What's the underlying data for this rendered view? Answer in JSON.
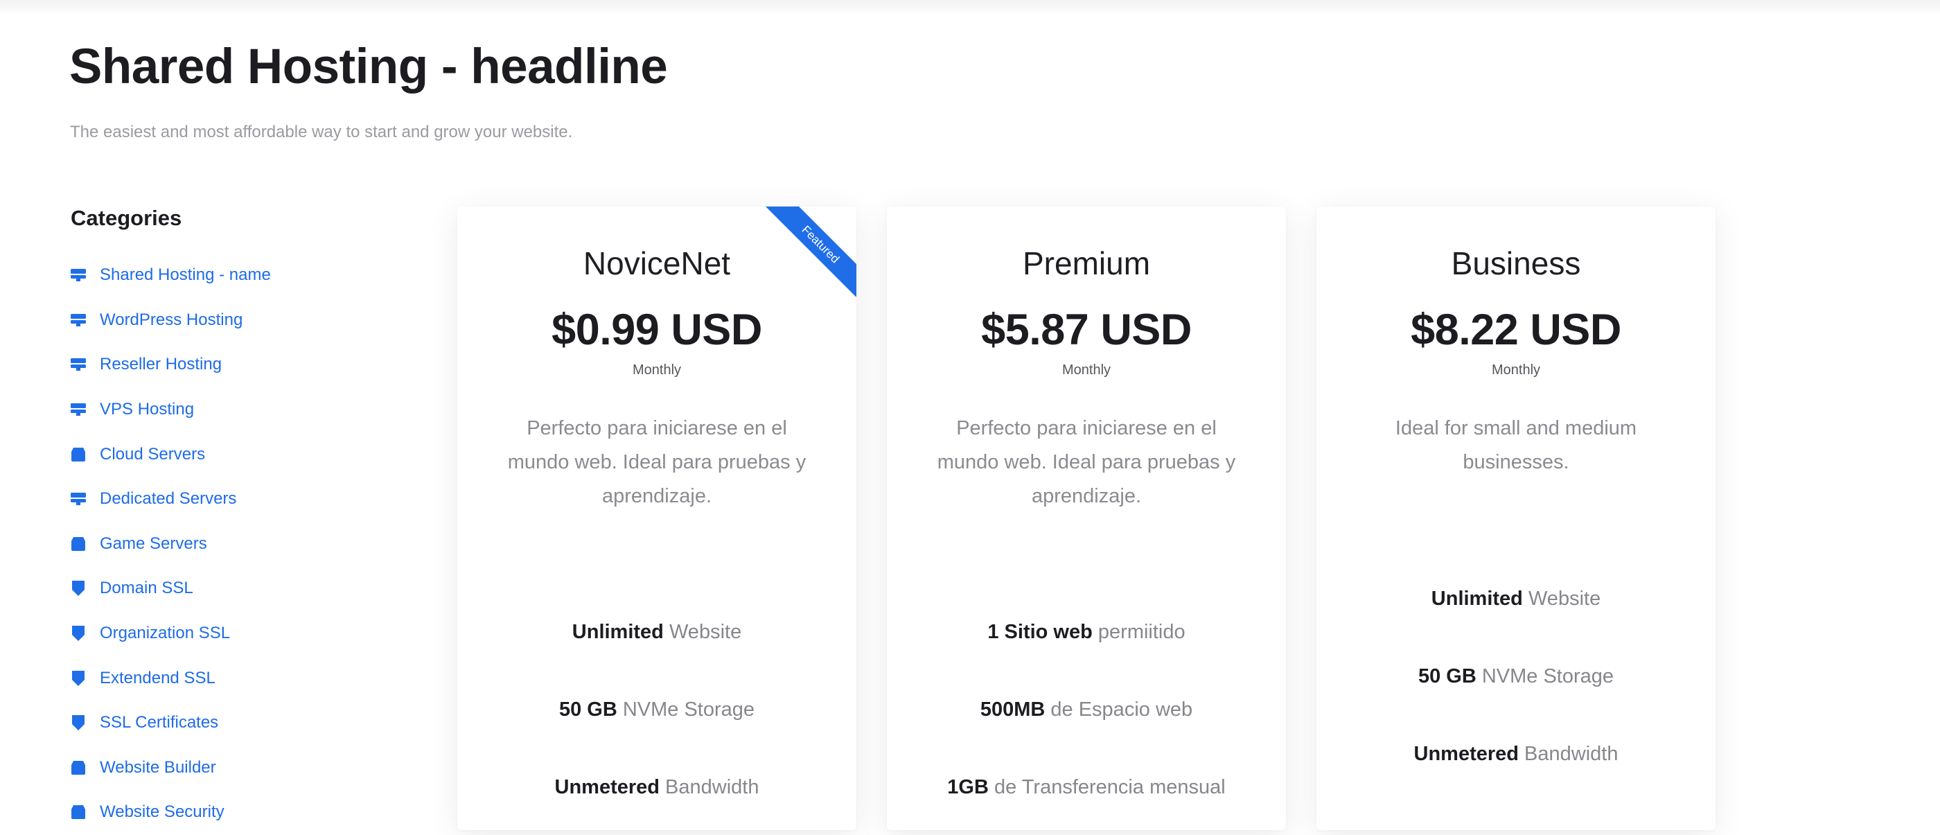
{
  "page": {
    "title": "Shared Hosting - headline",
    "subtitle": "The easiest and most affordable way to start and grow your website."
  },
  "sidebar": {
    "title": "Categories",
    "items": [
      {
        "label": "Shared Hosting - name",
        "icon": "server-icon"
      },
      {
        "label": "WordPress Hosting",
        "icon": "server-icon"
      },
      {
        "label": "Reseller Hosting",
        "icon": "server-icon"
      },
      {
        "label": "VPS Hosting",
        "icon": "server-icon"
      },
      {
        "label": "Cloud Servers",
        "icon": "box-icon"
      },
      {
        "label": "Dedicated Servers",
        "icon": "server-icon"
      },
      {
        "label": "Game Servers",
        "icon": "box-icon"
      },
      {
        "label": "Domain SSL",
        "icon": "shield-icon"
      },
      {
        "label": "Organization SSL",
        "icon": "shield-icon"
      },
      {
        "label": "Extendend SSL",
        "icon": "shield-icon"
      },
      {
        "label": "SSL Certificates",
        "icon": "shield-icon"
      },
      {
        "label": "Website Builder",
        "icon": "box-icon"
      },
      {
        "label": "Website Security",
        "icon": "box-icon"
      }
    ]
  },
  "plans": [
    {
      "name": "NoviceNet",
      "price": "$0.99 USD",
      "cycle": "Monthly",
      "description": "Perfecto para iniciarese en el mundo web. Ideal para pruebas y aprendizaje.",
      "ribbon": "Featured",
      "features": [
        {
          "strong": "Unlimited",
          "rest": " Website"
        },
        {
          "strong": "50 GB",
          "rest": " NVMe Storage"
        },
        {
          "strong": "Unmetered",
          "rest": " Bandwidth"
        }
      ]
    },
    {
      "name": "Premium",
      "price": "$5.87 USD",
      "cycle": "Monthly",
      "description": "Perfecto para iniciarese en el mundo web. Ideal para pruebas y aprendizaje.",
      "features": [
        {
          "strong": "1 Sitio web",
          "rest": " permiitido"
        },
        {
          "strong": "500MB",
          "rest": " de Espacio web"
        },
        {
          "strong": "1GB",
          "rest": " de Transferencia mensual"
        }
      ]
    },
    {
      "name": "Business",
      "price": "$8.22 USD",
      "cycle": "Monthly",
      "description": "Ideal for small and medium businesses.",
      "features": [
        {
          "strong": "Unlimited",
          "rest": " Website"
        },
        {
          "strong": "50 GB",
          "rest": " NVMe Storage"
        },
        {
          "strong": "Unmetered",
          "rest": " Bandwidth"
        }
      ]
    }
  ],
  "colors": {
    "accent": "#1f6ee8",
    "link": "#1d6ce8"
  }
}
